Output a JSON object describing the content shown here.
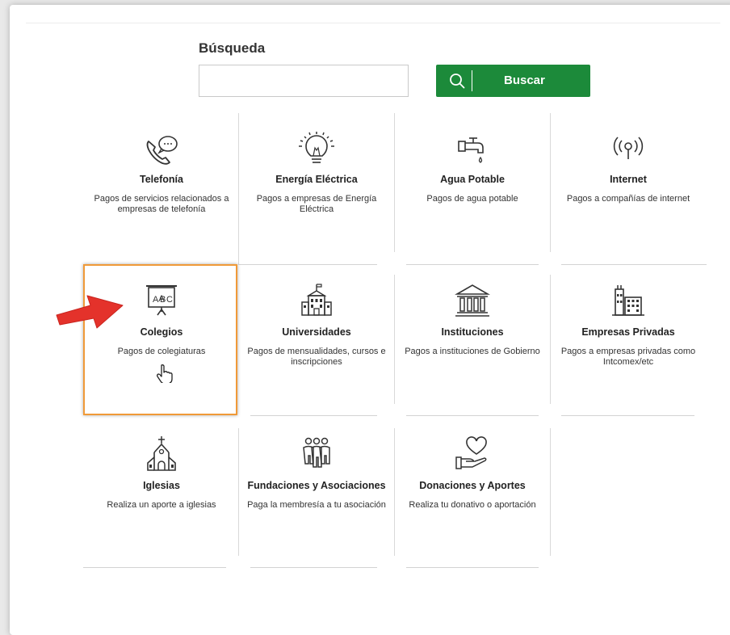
{
  "search": {
    "label": "Búsqueda",
    "value": "",
    "placeholder": "",
    "button_label": "Buscar"
  },
  "accent_color": "#1c8a3a",
  "highlight_color": "#f09a38",
  "categories": [
    {
      "icon": "phone-chat-icon",
      "title": "Telefonía",
      "desc": "Pagos de servicios relacionados a empresas de telefonía"
    },
    {
      "icon": "lightbulb-icon",
      "title": "Energía Eléctrica",
      "desc": "Pagos a empresas de Energía Eléctrica"
    },
    {
      "icon": "faucet-icon",
      "title": "Agua Potable",
      "desc": "Pagos de agua potable"
    },
    {
      "icon": "antenna-icon",
      "title": "Internet",
      "desc": "Pagos a compañías de internet"
    },
    {
      "icon": "blackboard-abc-icon",
      "title": "Colegios",
      "desc": "Pagos de colegiaturas"
    },
    {
      "icon": "university-building-icon",
      "title": "Universidades",
      "desc": "Pagos de mensualidades, cursos e inscripciones"
    },
    {
      "icon": "government-building-icon",
      "title": "Instituciones",
      "desc": "Pagos a instituciones de Gobierno"
    },
    {
      "icon": "factory-icon",
      "title": "Empresas Privadas",
      "desc": "Pagos a empresas privadas como Intcomex/etc"
    },
    {
      "icon": "church-icon",
      "title": "Iglesias",
      "desc": "Realiza un aporte a iglesias"
    },
    {
      "icon": "people-group-icon",
      "title": "Fundaciones y Asociaciones",
      "desc": "Paga la membresía a tu asociación"
    },
    {
      "icon": "heart-hand-icon",
      "title": "Donaciones y Aportes",
      "desc": "Realiza tu donativo o aportación"
    }
  ]
}
